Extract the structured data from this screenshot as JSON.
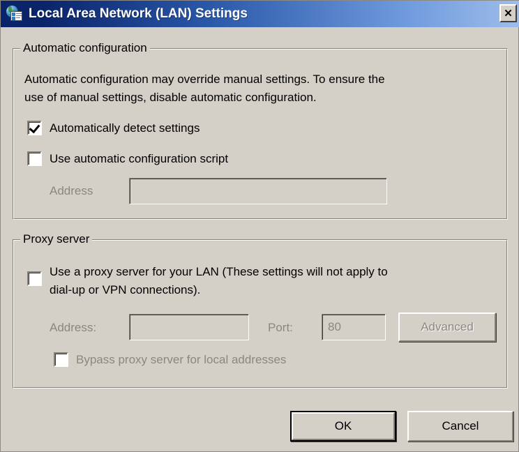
{
  "window": {
    "title": "Local Area Network (LAN) Settings",
    "icon": "internet-options-icon",
    "close_label": "✕"
  },
  "automatic_configuration": {
    "group_title": "Automatic configuration",
    "description_line1": "Automatic configuration may override manual settings.  To ensure the",
    "description_line2": "use of manual settings, disable automatic configuration.",
    "auto_detect": {
      "label": "Automatically detect settings",
      "checked": true,
      "enabled": true
    },
    "use_script": {
      "label": "Use automatic configuration script",
      "checked": false,
      "enabled": true
    },
    "address": {
      "label": "Address",
      "value": "",
      "placeholder": "",
      "enabled": false
    }
  },
  "proxy_server": {
    "group_title": "Proxy server",
    "use_proxy": {
      "label_line1": "Use a proxy server for your LAN (These settings will not apply to",
      "label_line2": "dial-up or VPN connections).",
      "checked": false,
      "enabled": true
    },
    "address": {
      "label": "Address:",
      "value": "",
      "enabled": false
    },
    "port": {
      "label": "Port:",
      "value": "80",
      "enabled": false
    },
    "advanced_button": {
      "label": "Advanced",
      "enabled": false
    },
    "bypass": {
      "label": "Bypass proxy server for local addresses",
      "checked": false,
      "enabled": false
    }
  },
  "footer": {
    "ok_label": "OK",
    "cancel_label": "Cancel"
  },
  "colors": {
    "dialog_face": "#d4d0c8",
    "title_gradient_start": "#0a246a",
    "title_gradient_end": "#9ebdea",
    "disabled_text": "#8a8782"
  }
}
